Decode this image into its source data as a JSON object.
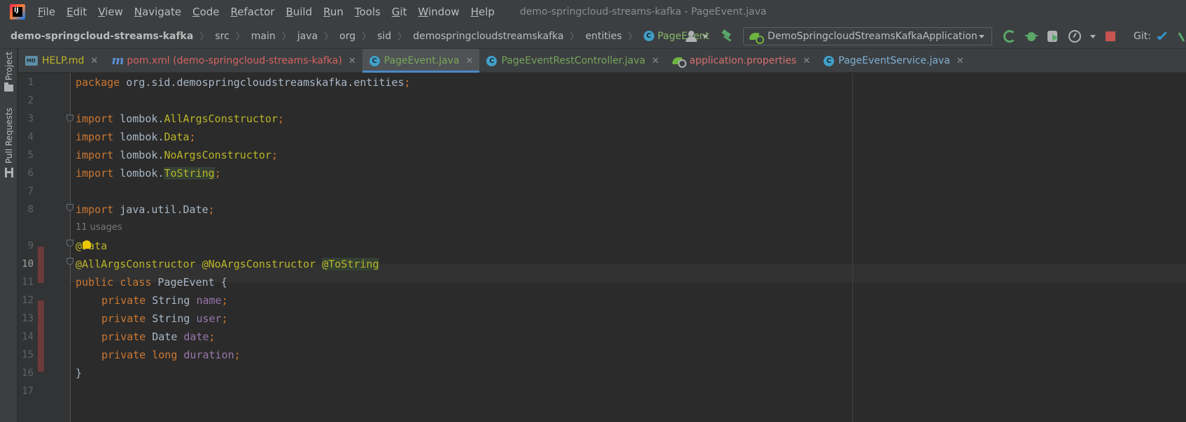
{
  "menu": {
    "items": [
      "File",
      "Edit",
      "View",
      "Navigate",
      "Code",
      "Refactor",
      "Build",
      "Run",
      "Tools",
      "Git",
      "Window",
      "Help"
    ],
    "window_title": "demo-springcloud-streams-kafka - PageEvent.java"
  },
  "breadcrumb": {
    "project": "demo-springcloud-streams-kafka",
    "parts": [
      "src",
      "main",
      "java",
      "org",
      "sid",
      "demospringcloudstreamskafka",
      "entities"
    ],
    "current": "PageEvent"
  },
  "toolbar": {
    "run_config": "DemoSpringcloudStreamsKafkaApplication",
    "git_label": "Git:"
  },
  "tool_windows": {
    "project": "Project",
    "pull_requests": "Pull Requests"
  },
  "tabs": [
    {
      "label": "HELP.md",
      "icon": "markdown-icon",
      "color": "#bbb529"
    },
    {
      "label": "pom.xml (demo-springcloud-streams-kafka)",
      "icon": "maven-icon",
      "color": "#d46161"
    },
    {
      "label": "PageEvent.java",
      "icon": "class-icon",
      "color": "#7aa65a",
      "active": true
    },
    {
      "label": "PageEventRestController.java",
      "icon": "class-icon",
      "color": "#76a55c"
    },
    {
      "label": "application.properties",
      "icon": "spring-properties-icon",
      "color": "#d46f6f"
    },
    {
      "label": "PageEventService.java",
      "icon": "class-icon",
      "color": "#7fb0d4"
    }
  ],
  "editor": {
    "line_numbers": [
      "1",
      "2",
      "3",
      "4",
      "5",
      "6",
      "7",
      "8",
      "9",
      "10",
      "11",
      "12",
      "13",
      "14",
      "15",
      "16",
      "17"
    ],
    "usages_hint": "11 usages",
    "current_line": "10",
    "code": {
      "l1_kw": "package",
      "l1_rest": " org.sid.demospringcloudstreamskafka.entities",
      "import_kw": "import",
      "lombok": " lombok.",
      "l3_cls": "AllArgsConstructor",
      "l4_cls": "Data",
      "l5_cls": "NoArgsConstructor",
      "l6_cls": "ToString",
      "l8_rest": " java.util.Date",
      "semi": ";",
      "l9_ann": "@Data",
      "l10_ann1": "@AllArgsConstructor",
      "l10_ann2": "@NoArgsConstructor",
      "l10_ann3": "@ToString",
      "l11_kw": "public class",
      "l11_rest": " PageEvent {",
      "private_kw": "private",
      "long_kw": "long",
      "l12_type": " String ",
      "l12_field": "name",
      "l13_type": " String ",
      "l13_field": "user",
      "l14_type": " Date ",
      "l14_field": "date",
      "l15_field": "duration",
      "l16": "}"
    }
  },
  "colors": {
    "keyword": "#cc7832",
    "annotation": "#bbb529",
    "field": "#9876aa",
    "text": "#a9b7c6",
    "accent": "#4a88c7"
  }
}
